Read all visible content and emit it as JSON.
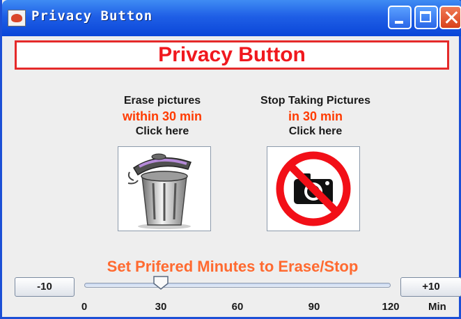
{
  "window": {
    "title": "Privacy Button"
  },
  "header": {
    "title": "Privacy Button"
  },
  "erase_panel": {
    "line1": "Erase pictures",
    "line2": "within 30 min",
    "line3": "Click here"
  },
  "stop_panel": {
    "line1": "Stop Taking Pictures",
    "line2": "in 30 min",
    "line3": "Click here"
  },
  "slider_section": {
    "label": "Set Prifered Minutes to Erase/Stop",
    "minus_button": "-10",
    "plus_button": "+10",
    "min": 0,
    "max": 120,
    "value": 30,
    "ticks": [
      "0",
      "30",
      "60",
      "90",
      "120"
    ],
    "unit": "Min"
  },
  "colors": {
    "header_red": "#f0181e",
    "accent_orange": "#ff6a30",
    "title_blue": "#1f5fe6"
  },
  "icons": [
    "java-cup-icon",
    "trash-can-icon",
    "no-camera-icon"
  ]
}
